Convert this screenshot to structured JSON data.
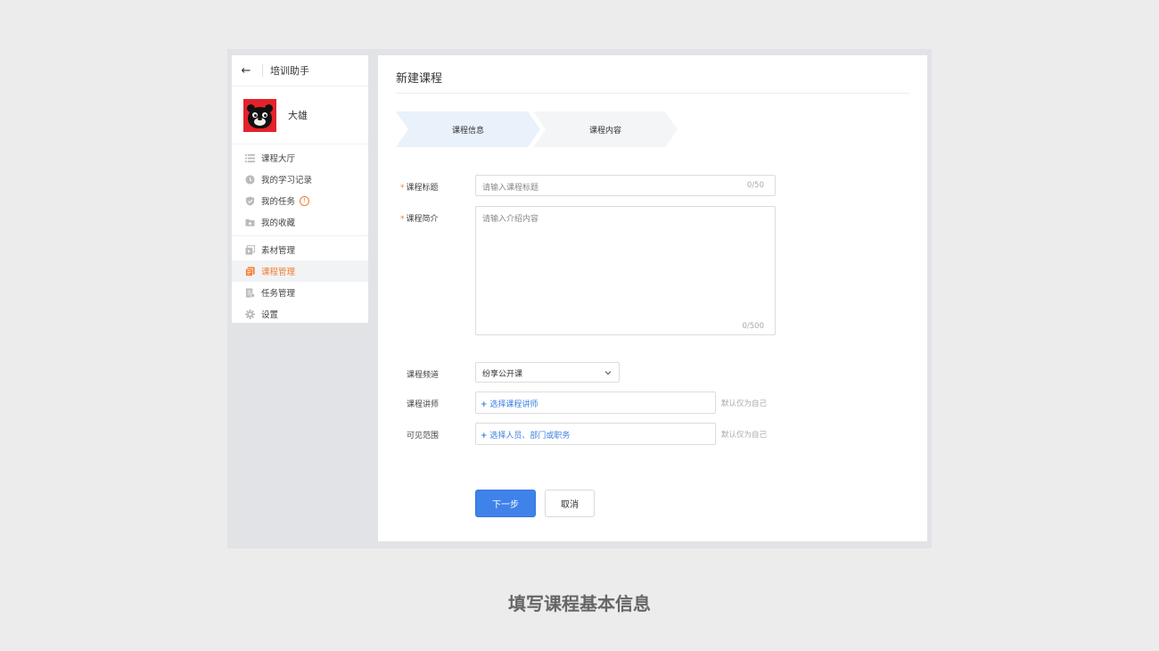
{
  "sidebar": {
    "app_title": "培训助手",
    "user_name": "大雄",
    "groups": [
      [
        {
          "label": "课程大厅",
          "icon": "list-icon"
        },
        {
          "label": "我的学习记录",
          "icon": "clock-icon"
        },
        {
          "label": "我的任务",
          "icon": "shield-icon",
          "badge": "!"
        },
        {
          "label": "我的收藏",
          "icon": "folder-icon"
        }
      ],
      [
        {
          "label": "素材管理",
          "icon": "media-icon"
        },
        {
          "label": "课程管理",
          "icon": "book-icon",
          "active": true
        },
        {
          "label": "任务管理",
          "icon": "clipboard-icon"
        },
        {
          "label": "设置",
          "icon": "gear-icon"
        }
      ]
    ]
  },
  "main": {
    "title": "新建课程",
    "steps": [
      {
        "label": "课程信息",
        "active": true
      },
      {
        "label": "课程内容",
        "active": false
      }
    ],
    "form": {
      "title_label": "课程标题",
      "title_required": "*",
      "title_placeholder": "请输入课程标题",
      "title_counter": "0/50",
      "intro_label": "课程简介",
      "intro_required": "*",
      "intro_placeholder": "请输入介绍内容",
      "intro_counter": "0/500",
      "channel_label": "课程频道",
      "channel_value": "纷享公开课",
      "teacher_label": "课程讲师",
      "teacher_picker": "选择课程讲师",
      "teacher_hint": "默认仅为自己",
      "scope_label": "可见范围",
      "scope_picker": "选择人员、部门或职务",
      "scope_hint": "默认仅为自己"
    },
    "buttons": {
      "next": "下一步",
      "cancel": "取消"
    }
  },
  "caption": "填写课程基本信息",
  "colors": {
    "accent": "#3f82ea",
    "active_menu": "#f07c2d",
    "step_active": "#e9f1fb",
    "step_inactive": "#f4f5f6"
  }
}
